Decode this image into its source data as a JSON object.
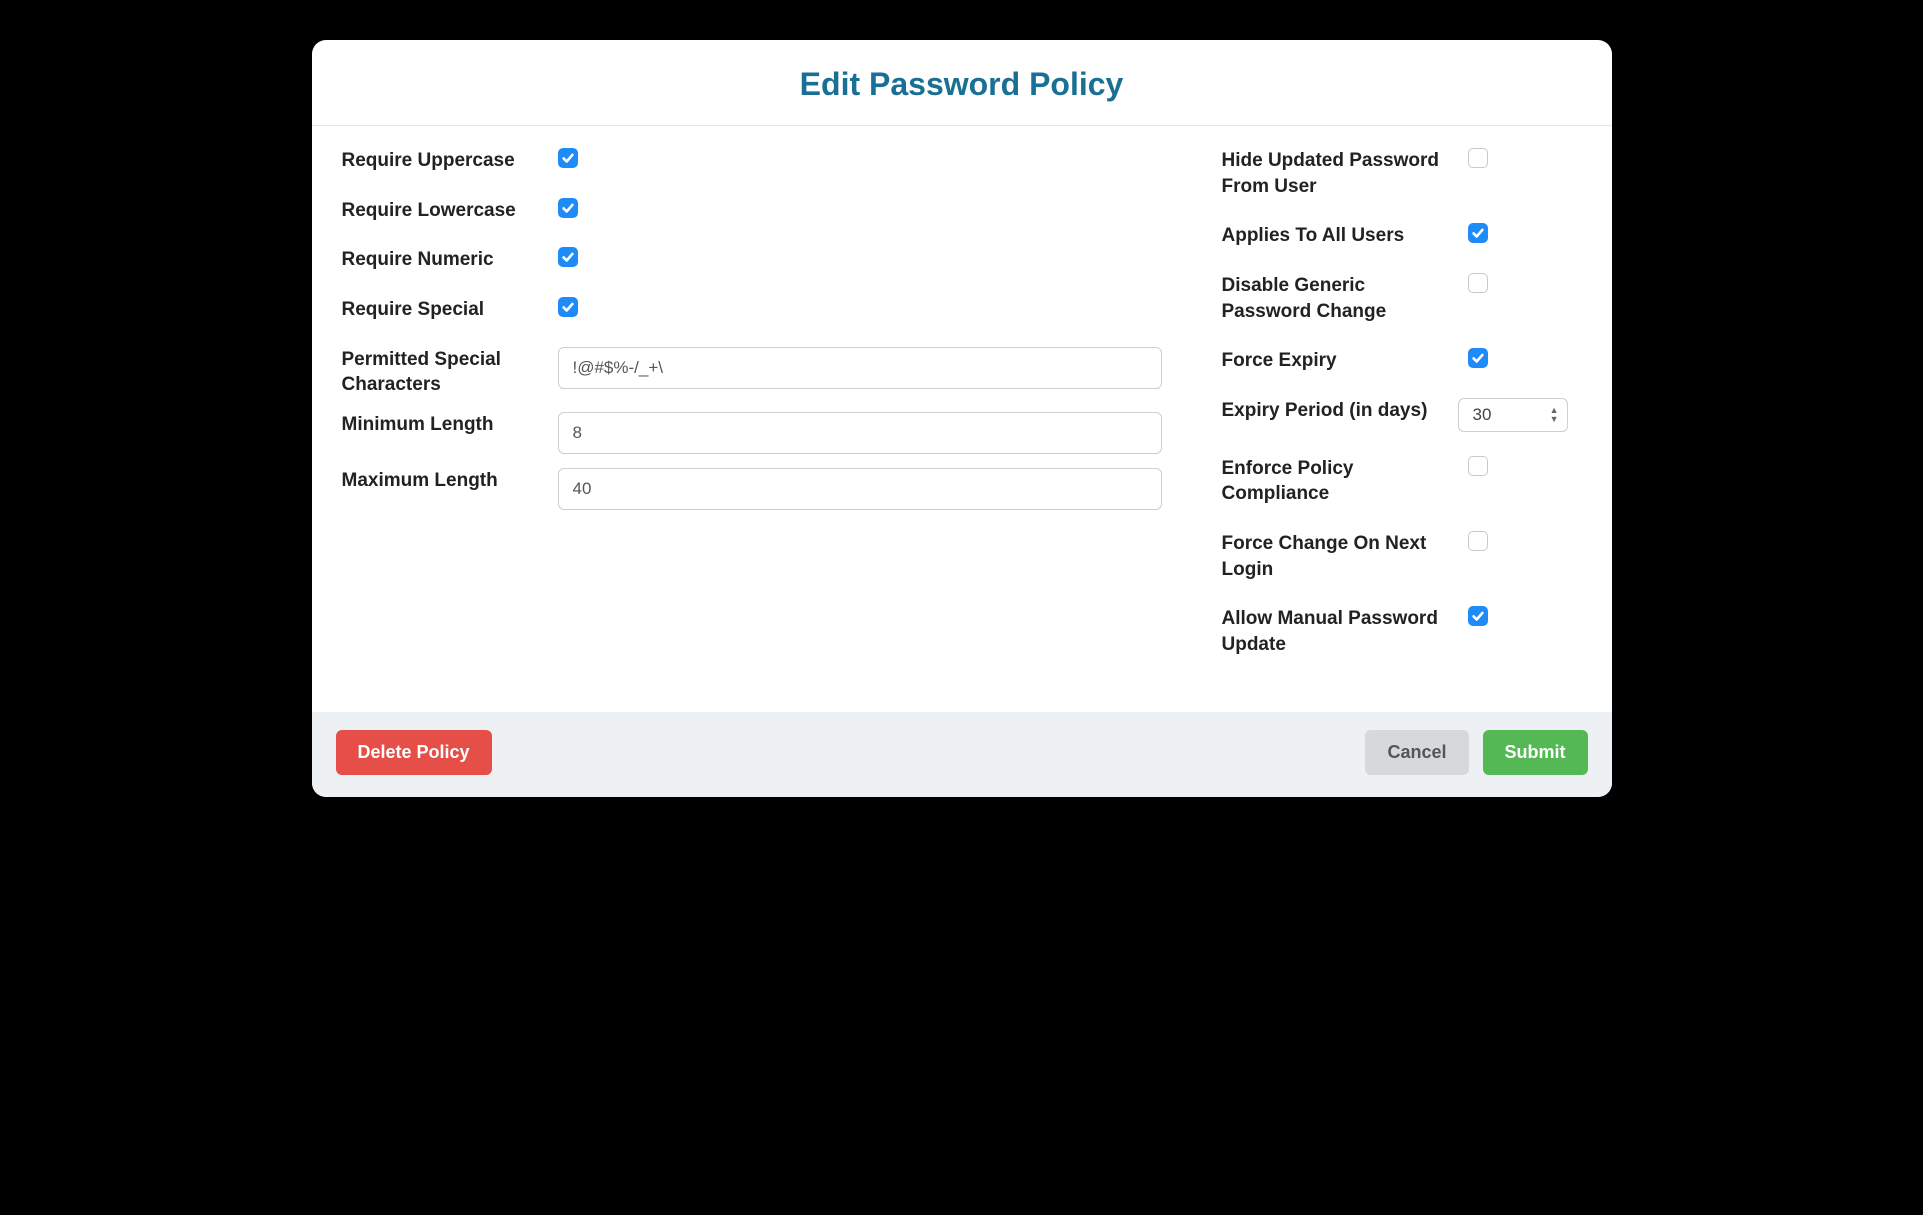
{
  "header": {
    "title": "Edit Password Policy"
  },
  "left": {
    "require_uppercase": {
      "label": "Require Uppercase",
      "checked": true
    },
    "require_lowercase": {
      "label": "Require Lowercase",
      "checked": true
    },
    "require_numeric": {
      "label": "Require Numeric",
      "checked": true
    },
    "require_special": {
      "label": "Require Special",
      "checked": true
    },
    "permitted_special": {
      "label": "Permitted Special Characters",
      "value": "!@#$%-/_+\\"
    },
    "min_length": {
      "label": "Minimum Length",
      "value": "8"
    },
    "max_length": {
      "label": "Maximum Length",
      "value": "40"
    }
  },
  "right": {
    "hide_updated": {
      "label": "Hide Updated Password From User",
      "checked": false
    },
    "applies_all": {
      "label": "Applies To All Users",
      "checked": true
    },
    "disable_generic": {
      "label": "Disable Generic Password Change",
      "checked": false
    },
    "force_expiry": {
      "label": "Force Expiry",
      "checked": true
    },
    "expiry_period": {
      "label": "Expiry Period (in days)",
      "value": "30"
    },
    "enforce_compliance": {
      "label": "Enforce Policy Compliance",
      "checked": false
    },
    "force_next_login": {
      "label": "Force Change On Next Login",
      "checked": false
    },
    "allow_manual": {
      "label": "Allow Manual Password Update",
      "checked": true
    }
  },
  "footer": {
    "delete_label": "Delete Policy",
    "cancel_label": "Cancel",
    "submit_label": "Submit"
  }
}
